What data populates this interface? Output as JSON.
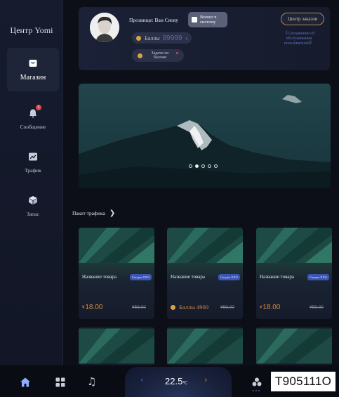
{
  "sidebar": {
    "brand": "Центр Yomi",
    "items": [
      {
        "label": "Магазин",
        "icon": "shop-bag-icon",
        "active": true
      },
      {
        "label": "Сообщение",
        "icon": "bell-icon",
        "badge": "1"
      },
      {
        "label": "Трафик",
        "icon": "traffic-chart-icon"
      },
      {
        "label": "Запас",
        "icon": "inventory-box-icon"
      }
    ]
  },
  "profile": {
    "nickname": "Прозвище: Ван Сяову",
    "login_button": "Вошел в систему",
    "points_label": "Баллы",
    "points_value": "99999",
    "tasks_label": "Задачи по баллам",
    "orders_button": "Центр заказов",
    "agreement_link": "《Соглашение об обслуживании пользователей》"
  },
  "banner": {
    "slide_count": 5,
    "active_slide": 1
  },
  "section": {
    "title": "Пакет трафика",
    "arrow": "❯"
  },
  "products": [
    {
      "name": "Название товара",
      "tag": "Скидка XX%",
      "price_prefix": "¥",
      "price": "18.00",
      "old_price": "¥59.00",
      "points": false
    },
    {
      "name": "Название товара",
      "tag": "Скидка XX%",
      "price_prefix": "",
      "price": "Баллы 4900",
      "old_price": "¥59.00",
      "points": true
    },
    {
      "name": "Название товара",
      "tag": "Скидка XX%",
      "price_prefix": "¥",
      "price": "18.00",
      "old_price": "¥59.00",
      "points": false
    }
  ],
  "bottom_bar": {
    "icons": [
      "home-icon",
      "apps-grid-icon",
      "music-note-icon",
      "fan-icon"
    ],
    "temp_down": "‹",
    "temperature": "22.5",
    "temp_unit": "℃",
    "temp_up": "›"
  },
  "overlay_code": "T905111O",
  "colors": {
    "background": "#0c0f17",
    "accent_blue": "#3c55b4",
    "price_orange": "#d68b43",
    "gold_border": "#b48d55"
  }
}
